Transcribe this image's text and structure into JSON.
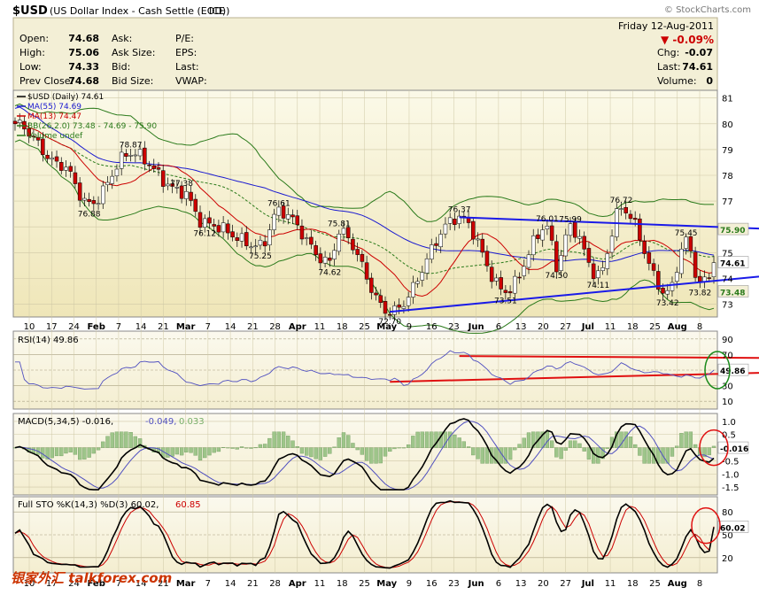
{
  "header": {
    "symbol": "$USD",
    "description": "(US Dollar Index - Cash Settle (EOD))",
    "exchange": "ICE",
    "watermark": "© StockCharts.com",
    "date": "Friday   12-Aug-2011",
    "change_pct": "▼ -0.09%",
    "change_color": "#cc0000"
  },
  "quote": {
    "left": [
      {
        "label": "Open:",
        "value": "74.68"
      },
      {
        "label": "High:",
        "value": "75.06"
      },
      {
        "label": "Low:",
        "value": "74.33"
      },
      {
        "label": "Prev Close:",
        "value": "74.68"
      }
    ],
    "mid": [
      "Ask:",
      "Ask Size:",
      "Bid:",
      "Bid Size:"
    ],
    "right_labels": [
      "P/E:",
      "EPS:",
      "Last:",
      "VWAP:"
    ],
    "far": [
      {
        "label": "Chg:",
        "value": "-0.07"
      },
      {
        "label": "Last:",
        "value": "74.61"
      },
      {
        "label": "Volume:",
        "value": "0"
      }
    ]
  },
  "main_legend": [
    {
      "text": "$USD (Daily) 74.61",
      "color": "#000000"
    },
    {
      "text": "MA(55) 74.69",
      "color": "#1a1ad0"
    },
    {
      "text": "MA(13) 74.47",
      "color": "#cc0000"
    },
    {
      "text": "BB(26,2.0) 73.48 - 74.69 - 75.90",
      "color": "#2a7a1a"
    },
    {
      "text": "Volume undef",
      "color": "#2a7a1a"
    }
  ],
  "rsi_legend": "RSI(14) 49.86",
  "macd_legend": {
    "a": "MACD(5,34,5) -0.016,",
    "b": "-0.049,",
    "c": "0.033"
  },
  "sto_legend": {
    "a": "Full STO %K(14,3) %D(3) 60.02,",
    "b": "60.85"
  },
  "price_ticks": [
    "81",
    "80",
    "79",
    "78",
    "77",
    "76",
    "75",
    "74",
    "73"
  ],
  "rsi_ticks": [
    "90",
    "70",
    "50",
    "30",
    "10"
  ],
  "macd_ticks": [
    "1.0",
    "0.5",
    "0.0",
    "-0.5",
    "-1.0",
    "-1.5"
  ],
  "sto_ticks": [
    "80",
    "50",
    "20"
  ],
  "x_labels": [
    "10",
    "17",
    "24",
    "Feb",
    "7",
    "14",
    "21",
    "Mar",
    "7",
    "14",
    "21",
    "28",
    "Apr",
    "11",
    "18",
    "25",
    "May",
    "9",
    "16",
    "23",
    "Jun",
    "6",
    "13",
    "20",
    "27",
    "Jul",
    "11",
    "18",
    "25",
    "Aug",
    "8"
  ],
  "bottom_watermark": "银家外汇 talkforex.com",
  "price_annotations": [
    "78.87",
    "76.88",
    "77.38",
    "76.12",
    "75.25",
    "76.61",
    "75.81",
    "74.62",
    "72.70",
    "76.37",
    "73.51",
    "76.01",
    "75.99",
    "74.50",
    "74.11",
    "76.72",
    "75.45",
    "73.42",
    "73.82"
  ],
  "value_tags": {
    "price": "74.61",
    "bb_upper": "75.90",
    "bb_lower": "73.48",
    "rsi": "49.86",
    "macd": "-0.016",
    "sto": "60.02"
  },
  "chart_data": {
    "type": "candlestick",
    "title": "$USD (US Dollar Index - Cash Settle (EOD)) ICE",
    "x_start": "2011-01-10",
    "x_end": "2011-08-12",
    "price_range": [
      72.5,
      81.3
    ],
    "key_points": [
      {
        "date": "2011-01-10",
        "close": 80.0
      },
      {
        "date": "2011-01-24",
        "close": 78.4
      },
      {
        "date": "2011-02-02",
        "low": 76.88
      },
      {
        "date": "2011-02-14",
        "high": 78.87
      },
      {
        "date": "2011-03-01",
        "high": 77.38
      },
      {
        "date": "2011-03-08",
        "low": 76.12
      },
      {
        "date": "2011-03-25",
        "low": 75.25
      },
      {
        "date": "2011-03-31",
        "high": 76.61
      },
      {
        "date": "2011-04-18",
        "high": 75.81
      },
      {
        "date": "2011-04-15",
        "low": 74.62
      },
      {
        "date": "2011-05-04",
        "low": 72.7
      },
      {
        "date": "2011-05-24",
        "high": 76.37
      },
      {
        "date": "2011-06-07",
        "low": 73.51
      },
      {
        "date": "2011-06-20",
        "high": 76.01
      },
      {
        "date": "2011-06-27",
        "high": 75.99
      },
      {
        "date": "2011-06-23",
        "low": 74.5
      },
      {
        "date": "2011-07-06",
        "low": 74.11
      },
      {
        "date": "2011-07-12",
        "high": 76.72
      },
      {
        "date": "2011-08-01",
        "high": 75.45
      },
      {
        "date": "2011-07-27",
        "low": 73.42
      },
      {
        "date": "2011-08-05",
        "low": 73.82
      },
      {
        "date": "2011-08-12",
        "close": 74.61
      }
    ],
    "indicators": {
      "MA55": 74.69,
      "MA13": 74.47,
      "BB": {
        "lower": 73.48,
        "mid": 74.69,
        "upper": 75.9
      },
      "RSI14": 49.86,
      "MACD": {
        "macd": -0.016,
        "signal": -0.049,
        "hist": 0.033
      },
      "STO": {
        "k": 60.02,
        "d": 60.85
      }
    },
    "panels": [
      {
        "name": "price",
        "ylim": [
          72.5,
          81.3
        ]
      },
      {
        "name": "RSI",
        "ylim": [
          0,
          100
        ]
      },
      {
        "name": "MACD",
        "ylim": [
          -1.8,
          1.3
        ]
      },
      {
        "name": "STO",
        "ylim": [
          0,
          100
        ]
      }
    ],
    "trendlines": [
      {
        "color": "blue",
        "from": {
          "date": "2011-05-24",
          "y": 76.37
        },
        "to": {
          "date": "2011-08-12",
          "y": 76.0
        }
      },
      {
        "color": "blue",
        "from": {
          "date": "2011-05-04",
          "y": 72.7
        },
        "to": {
          "date": "2011-08-12",
          "y": 73.9
        }
      },
      {
        "color": "red",
        "panel": "RSI",
        "from": {
          "date": "2011-05-24",
          "y": 68
        },
        "to": {
          "date": "2011-08-12",
          "y": 66
        }
      },
      {
        "color": "red",
        "panel": "RSI",
        "from": {
          "date": "2011-05-04",
          "y": 35
        },
        "to": {
          "date": "2011-08-12",
          "y": 45
        }
      }
    ]
  }
}
